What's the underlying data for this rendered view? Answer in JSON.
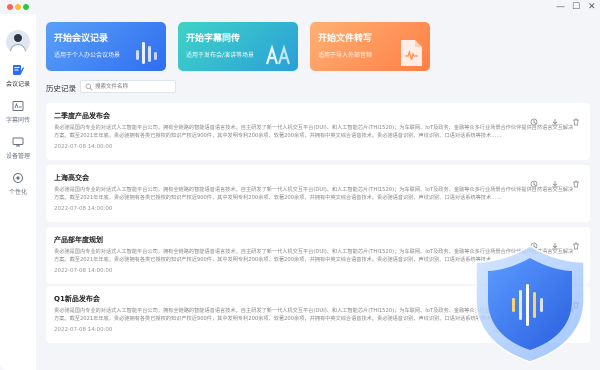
{
  "window_controls": {
    "minimize": "—",
    "maximize": "☐",
    "close": "✕"
  },
  "sidebar": {
    "items": [
      {
        "label": "会议记录",
        "icon": "meeting-notes-icon",
        "active": true
      },
      {
        "label": "字幕同传",
        "icon": "subtitle-icon",
        "active": false
      },
      {
        "label": "设备管理",
        "icon": "device-icon",
        "active": false
      },
      {
        "label": "个性化",
        "icon": "personalize-icon",
        "active": false
      }
    ]
  },
  "cards": [
    {
      "title": "开始会议记录",
      "subtitle": "适用于个人办公会议场景",
      "icon": "waveform-icon"
    },
    {
      "title": "开始字幕同传",
      "subtitle": "适用于发布会/演讲等场景",
      "icon": "aa-text-icon"
    },
    {
      "title": "开始文件转写",
      "subtitle": "适用于导入外部音频",
      "icon": "audio-file-icon"
    }
  ],
  "history": {
    "title": "历史记录",
    "search_placeholder": "搜索文件名称"
  },
  "records": [
    {
      "title": "二季度产品发布会",
      "text": "贵必驰是国内专业的对话式人工智能平台公司，拥有全链路的智能语音语言技术。自主研发了新一代人机交互平台(DUI)、和人工智能芯片(THI1520)；为车联网、IoT及政务、金融等众多行业场景合作伙伴提供自然语言交互解决方案。截至2021年年底，贵必驰拥有各类已授权的知识产权近900件，其中发明专利200余项、软著200余项，并拥有中英文综合语音技术。贵必驰语音识别、声纹识别、口语对话系统等技术……",
      "time": "2022-07-08 14:00:00"
    },
    {
      "title": "上海高交会",
      "text": "贵必驰是国内专业的对话式人工智能平台公司，拥有全链路的智能语音语言技术。自主研发了新一代人机交互平台(DUI)、和人工智能芯片(THI1520)；为车联网、IoT及政务、金融等众多行业场景合作伙伴提供自然语言交互解决方案。截至2021年年底，贵必驰拥有各类已授权的知识产权近900件，其中发明专利200余项、软著200余项，并拥有中英文综合语音技术。贵必驰语音识别、声纹识别、口语对话系统等技术……",
      "time": "2022-07-08 14:00:00"
    },
    {
      "title": "产品部年度规划",
      "text": "贵必驰是国内专业的对话式人工智能平台公司，拥有全链路的智能语音语言技术。自主研发了新一代人机交互平台(DUI)、和人工智能芯片(THI1520)；为车联网、IoT及政务、金融等众多行业场景合作伙伴提供自然语言交互解决方案。截至2021年年底，贵必驰拥有各类已授权的知识产权近900件，其中发明专利200余项、软著200余项，并拥有中英文综合语音技术。贵必驰语音识别、声纹识别、口语对话系统等技术……",
      "time": "2022-07-08 14:00:00"
    },
    {
      "title": "Q1新品发布会",
      "text": "贵必驰是国内专业的对话式人工智能平台公司，拥有全链路的智能语音语言技术。自主研发了新一代人机交互平台(DUI)、和人工智能芯片(THI1520)；为车联网、IoT及政务、金融等众多行业场景合作伙伴提供自然语言交互解决方案。截至2021年年底，贵必驰拥有各类已授权的知识产权近900件，其中发明专利200余项、软著200余项，并拥有中英文综合语音技术。贵必驰语音识别、声纹识别、口语对话系统等技术……",
      "time": "2022-07-08 14:00:00"
    }
  ],
  "colors": {
    "card1": "#2f6df0",
    "card2": "#2a9fd8",
    "card3": "#ff7f45",
    "shield": "#3b7cf5"
  }
}
